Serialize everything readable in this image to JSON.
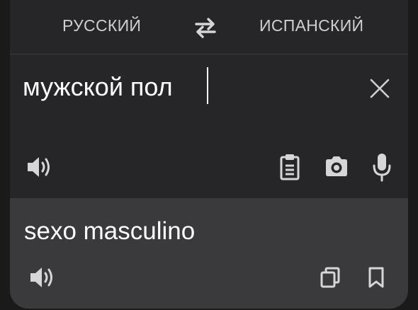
{
  "header": {
    "source_language": "РУССКИЙ",
    "target_language": "ИСПАНСКИЙ",
    "swap_icon": "swap-arrows-icon"
  },
  "input": {
    "text": "мужской пол",
    "clear_icon": "close-icon",
    "listen_icon": "speaker-icon",
    "paste_icon": "clipboard-icon",
    "camera_icon": "camera-icon",
    "voice_icon": "microphone-icon"
  },
  "output": {
    "text": "sexo masculino",
    "listen_icon": "speaker-icon",
    "copy_icon": "copy-icon",
    "bookmark_icon": "bookmark-icon"
  },
  "colors": {
    "background": "#1a1a1a",
    "card": "#262628",
    "output_panel": "#3a3a3d",
    "text": "#ffffff",
    "language_label": "#cfcfd2",
    "icon": "#d6d6d8"
  }
}
